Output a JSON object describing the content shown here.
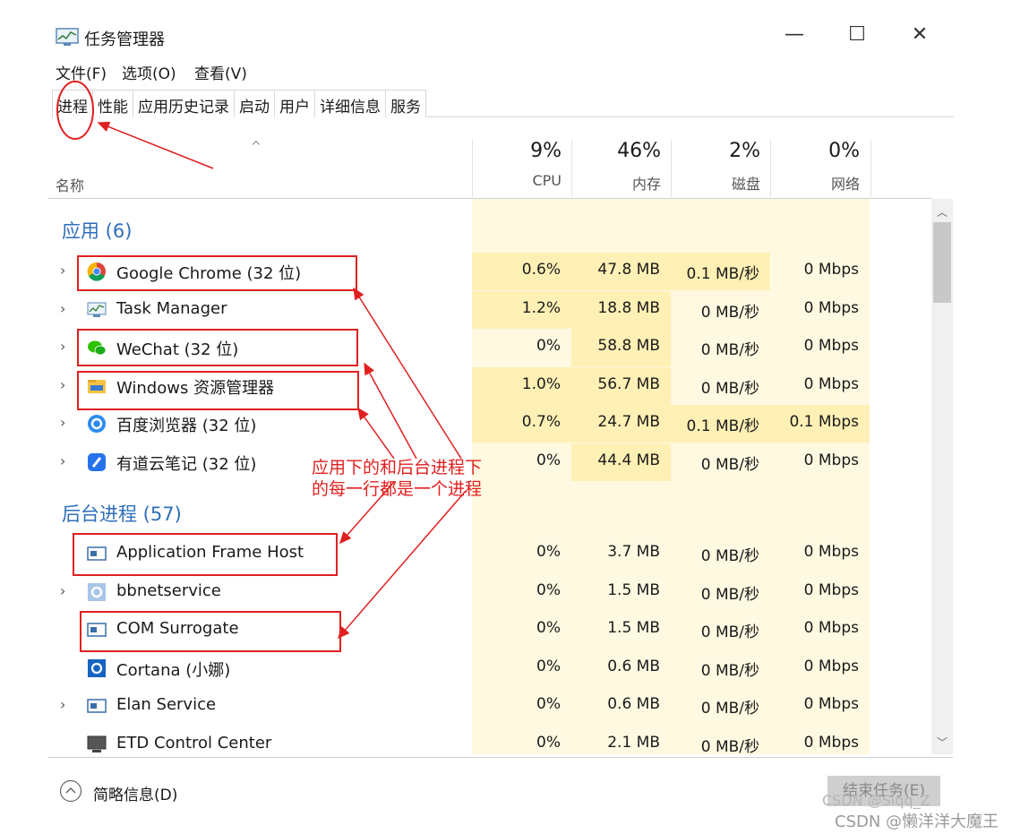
{
  "window": {
    "title": "任务管理器",
    "controls": {
      "minimize": "—",
      "maximize": "☐",
      "close": "✕"
    }
  },
  "menu": [
    "文件(F)",
    "选项(O)",
    "查看(V)"
  ],
  "tabs": [
    "进程",
    "性能",
    "应用历史记录",
    "启动",
    "用户",
    "详细信息",
    "服务"
  ],
  "columns": {
    "name": "名称",
    "sort_caret": "^",
    "cpu": {
      "percent": "9%",
      "label": "CPU"
    },
    "memory": {
      "percent": "46%",
      "label": "内存"
    },
    "disk": {
      "percent": "2%",
      "label": "磁盘"
    },
    "network": {
      "percent": "0%",
      "label": "网络"
    }
  },
  "groups": {
    "apps": "应用 (6)",
    "background": "后台进程 (57)"
  },
  "apps": [
    {
      "name": "Google Chrome (32 位)",
      "icon": "chrome-icon",
      "cpu": "0.6%",
      "mem": "47.8 MB",
      "disk": "0.1 MB/秒",
      "net": "0 Mbps"
    },
    {
      "name": "Task Manager",
      "icon": "task-manager-icon",
      "cpu": "1.2%",
      "mem": "18.8 MB",
      "disk": "0 MB/秒",
      "net": "0 Mbps"
    },
    {
      "name": "WeChat (32 位)",
      "icon": "wechat-icon",
      "cpu": "0%",
      "mem": "58.8 MB",
      "disk": "0 MB/秒",
      "net": "0 Mbps"
    },
    {
      "name": "Windows 资源管理器",
      "icon": "folder-icon",
      "cpu": "1.0%",
      "mem": "56.7 MB",
      "disk": "0 MB/秒",
      "net": "0 Mbps"
    },
    {
      "name": "百度浏览器 (32 位)",
      "icon": "baidu-browser-icon",
      "cpu": "0.7%",
      "mem": "24.7 MB",
      "disk": "0.1 MB/秒",
      "net": "0.1 Mbps"
    },
    {
      "name": "有道云笔记 (32 位)",
      "icon": "youdao-note-icon",
      "cpu": "0%",
      "mem": "44.4 MB",
      "disk": "0 MB/秒",
      "net": "0 Mbps"
    }
  ],
  "background": [
    {
      "name": "Application Frame Host",
      "icon": "app-window-icon",
      "cpu": "0%",
      "mem": "3.7 MB",
      "disk": "0 MB/秒",
      "net": "0 Mbps"
    },
    {
      "name": "bbnetservice",
      "icon": "service-gear-icon",
      "cpu": "0%",
      "mem": "1.5 MB",
      "disk": "0 MB/秒",
      "net": "0 Mbps"
    },
    {
      "name": "COM Surrogate",
      "icon": "app-window-icon",
      "cpu": "0%",
      "mem": "1.5 MB",
      "disk": "0 MB/秒",
      "net": "0 Mbps"
    },
    {
      "name": "Cortana (小娜)",
      "icon": "cortana-icon",
      "cpu": "0%",
      "mem": "0.6 MB",
      "disk": "0 MB/秒",
      "net": "0 Mbps"
    },
    {
      "name": "Elan Service",
      "icon": "app-window-icon",
      "cpu": "0%",
      "mem": "0.6 MB",
      "disk": "0 MB/秒",
      "net": "0 Mbps"
    },
    {
      "name": "ETD Control Center",
      "icon": "monitor-icon",
      "cpu": "0%",
      "mem": "2.1 MB",
      "disk": "0 MB/秒",
      "net": "0 Mbps"
    }
  ],
  "footer": {
    "fewer_details": "简略信息(D)",
    "end_task": "结束任务(E)"
  },
  "annotation": "应用下的和后台进程下\n的每一行都是一个进程",
  "watermarks": [
    "CSDN @Slqq_Z",
    "CSDN @懒洋洋大魔王"
  ],
  "colors": {
    "accent_text": "#2e6fba",
    "annotation": "#e02020",
    "heat": "#fff0b5",
    "heat_light": "#fff9e1"
  }
}
